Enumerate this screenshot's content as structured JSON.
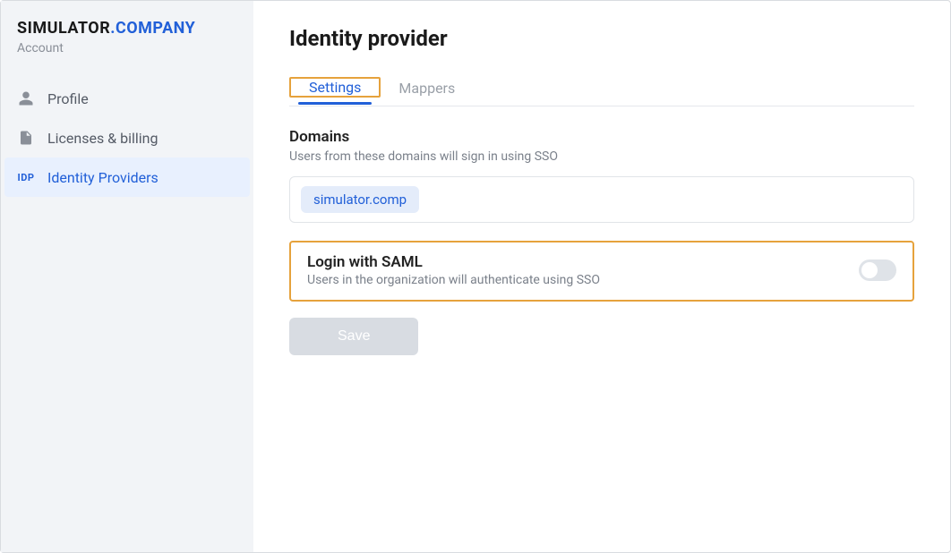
{
  "brand": {
    "part1": "SIMULATOR",
    "part2": ".COMPANY"
  },
  "sidebar": {
    "account_label": "Account",
    "items": [
      {
        "label": "Profile"
      },
      {
        "label": "Licenses & billing"
      },
      {
        "label": "Identity Providers",
        "badge": "IDP",
        "active": true
      }
    ]
  },
  "page": {
    "title": "Identity provider"
  },
  "tabs": [
    {
      "label": "Settings",
      "active": true
    },
    {
      "label": "Mappers",
      "active": false
    }
  ],
  "domains_section": {
    "title": "Domains",
    "subtitle": "Users from these domains will sign in using SSO",
    "chips": [
      "simulator.comp"
    ]
  },
  "saml_section": {
    "title": "Login with SAML",
    "subtitle": "Users in the organization will authenticate using SSO",
    "enabled": false
  },
  "actions": {
    "save_label": "Save"
  }
}
